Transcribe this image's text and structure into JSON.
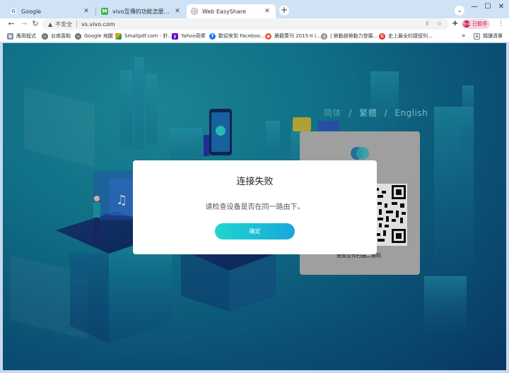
{
  "tabs": [
    {
      "title": "Google",
      "favicon": "G",
      "color": "#ffffff",
      "fg": "#4285f4"
    },
    {
      "title": "vivo互傳的功能怎麼用？ - Mobi",
      "favicon": "M",
      "color": "#3bb54a",
      "fg": "#ffffff"
    },
    {
      "title": "Web EasyShare",
      "favicon": "◎",
      "color": "#ffffff",
      "fg": "#555555"
    }
  ],
  "toolbar": {
    "security": "不安全",
    "url": "vs.vivo.com",
    "profile": "已暫停",
    "profile_avatar": "暫停"
  },
  "bookmarks": [
    {
      "label": "應用程式",
      "icon": "apps-icon",
      "color": "#7b8fa6"
    },
    {
      "label": "台南喜點",
      "icon": "globe-icon",
      "color": "#666666"
    },
    {
      "label": "Google 地圖",
      "icon": "globe-icon",
      "color": "#666666"
    },
    {
      "label": "Smallpdf.com - 針...",
      "icon": "smallpdf-icon",
      "color": "#e23b3b"
    },
    {
      "label": "Yahoo奇摩",
      "icon": "yahoo-icon",
      "color": "#6001d2"
    },
    {
      "label": "歡迎來到 Faceboo...",
      "icon": "facebook-icon",
      "color": "#1877f2"
    },
    {
      "label": "晨觀菁刊 2015-II (...",
      "icon": "journal-icon",
      "color": "#e2572b"
    },
    {
      "label": "| 勞動部勞動力發展...",
      "icon": "labor-icon",
      "color": "#8a8a8a"
    },
    {
      "label": "史上最全的捷徑列...",
      "icon": "shortcut-icon",
      "color": "#d93025"
    }
  ],
  "bookmarks_more": "»",
  "reading_list": "閱讀清單",
  "page": {
    "lang": {
      "simplified": "简体",
      "sep": "/",
      "traditional": "繁體",
      "english": "English"
    },
    "brand": "页传",
    "qr_hint": "使用互传扫描二维码"
  },
  "modal": {
    "title": "连接失败",
    "message": "请检查设备是否在同一路由下。",
    "confirm": "确定"
  },
  "colors": {
    "accent_start": "#1ed6cc",
    "accent_end": "#1aa6dc",
    "bg_dark": "#0a3f72",
    "bg_teal": "#137f98"
  }
}
